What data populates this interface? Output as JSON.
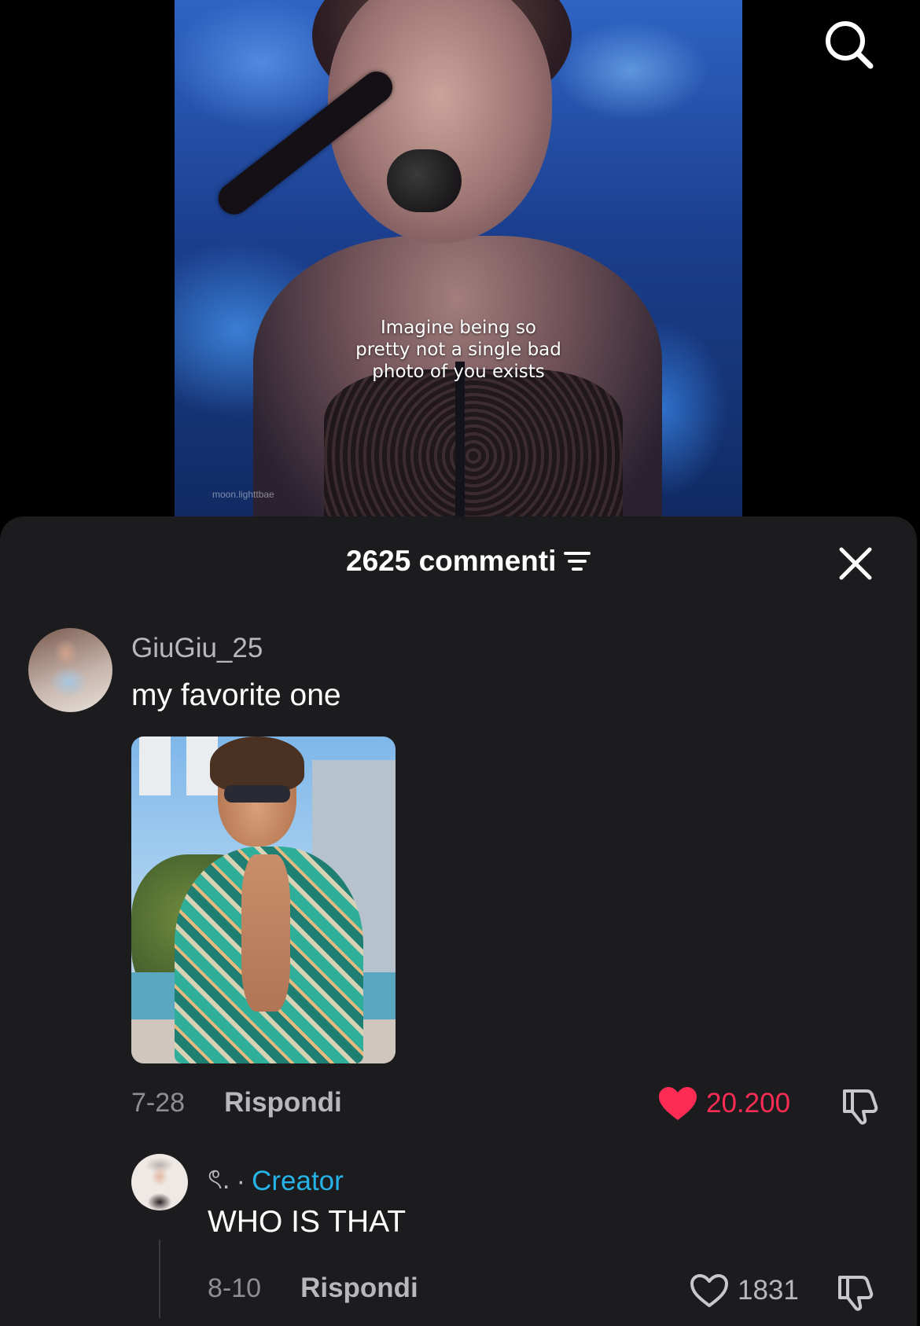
{
  "video": {
    "caption_line1": "Imagine being so",
    "caption_line2": "pretty not a single bad",
    "caption_line3": "photo of you exists",
    "watermark": "moon.lighttbae"
  },
  "header": {
    "search_icon": "search-icon"
  },
  "comments_sheet": {
    "title": "2625 commenti",
    "sort_icon": "sort-filter-icon",
    "close_icon": "close-icon",
    "comments": [
      {
        "username": "GiuGiu_25",
        "text": "my favorite one",
        "date": "7-28",
        "reply_label": "Rispondi",
        "likes": "20.200",
        "liked": true,
        "like_color": "#fe2c55"
      }
    ],
    "replies": [
      {
        "username": "ৎ.",
        "separator": "·",
        "badge": "Creator",
        "badge_color": "#25b3e8",
        "text": "WHO IS THAT",
        "date": "8-10",
        "reply_label": "Rispondi",
        "likes": "1831",
        "liked": false
      }
    ]
  }
}
